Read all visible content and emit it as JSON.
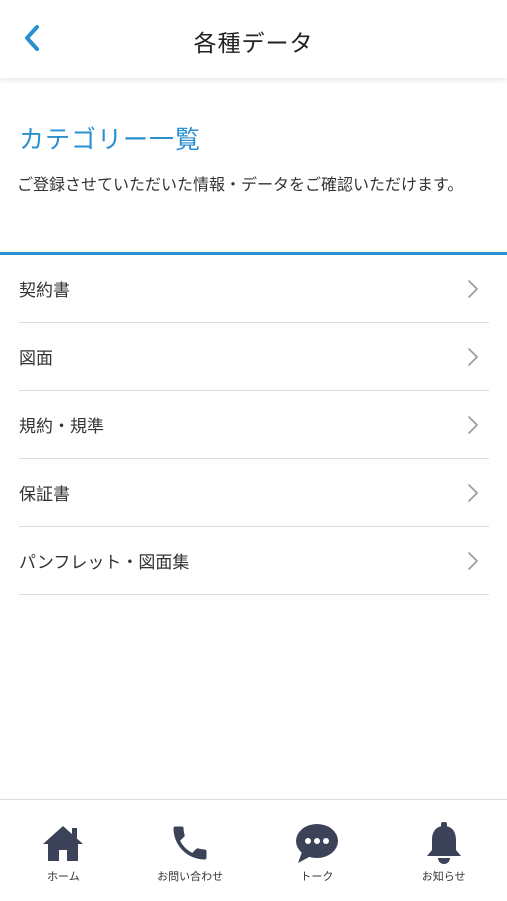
{
  "header": {
    "title": "各種データ",
    "back_icon": "chevron-left-icon"
  },
  "section": {
    "heading": "カテゴリー一覧",
    "description": "ご登録させていただいた情報・データをご確認いただけます。"
  },
  "categories": [
    {
      "label": "契約書"
    },
    {
      "label": "図面"
    },
    {
      "label": "規約・規準"
    },
    {
      "label": "保証書"
    },
    {
      "label": "パンフレット・図面集"
    }
  ],
  "tabbar": {
    "tabs": [
      {
        "label": "ホーム",
        "icon": "home-icon"
      },
      {
        "label": "お問い合わせ",
        "icon": "phone-icon"
      },
      {
        "label": "トーク",
        "icon": "chat-icon"
      },
      {
        "label": "お知らせ",
        "icon": "bell-icon"
      }
    ]
  },
  "colors": {
    "accent": "#2a8fd0",
    "icon": "#3c4257",
    "divider": "#dddddd"
  }
}
